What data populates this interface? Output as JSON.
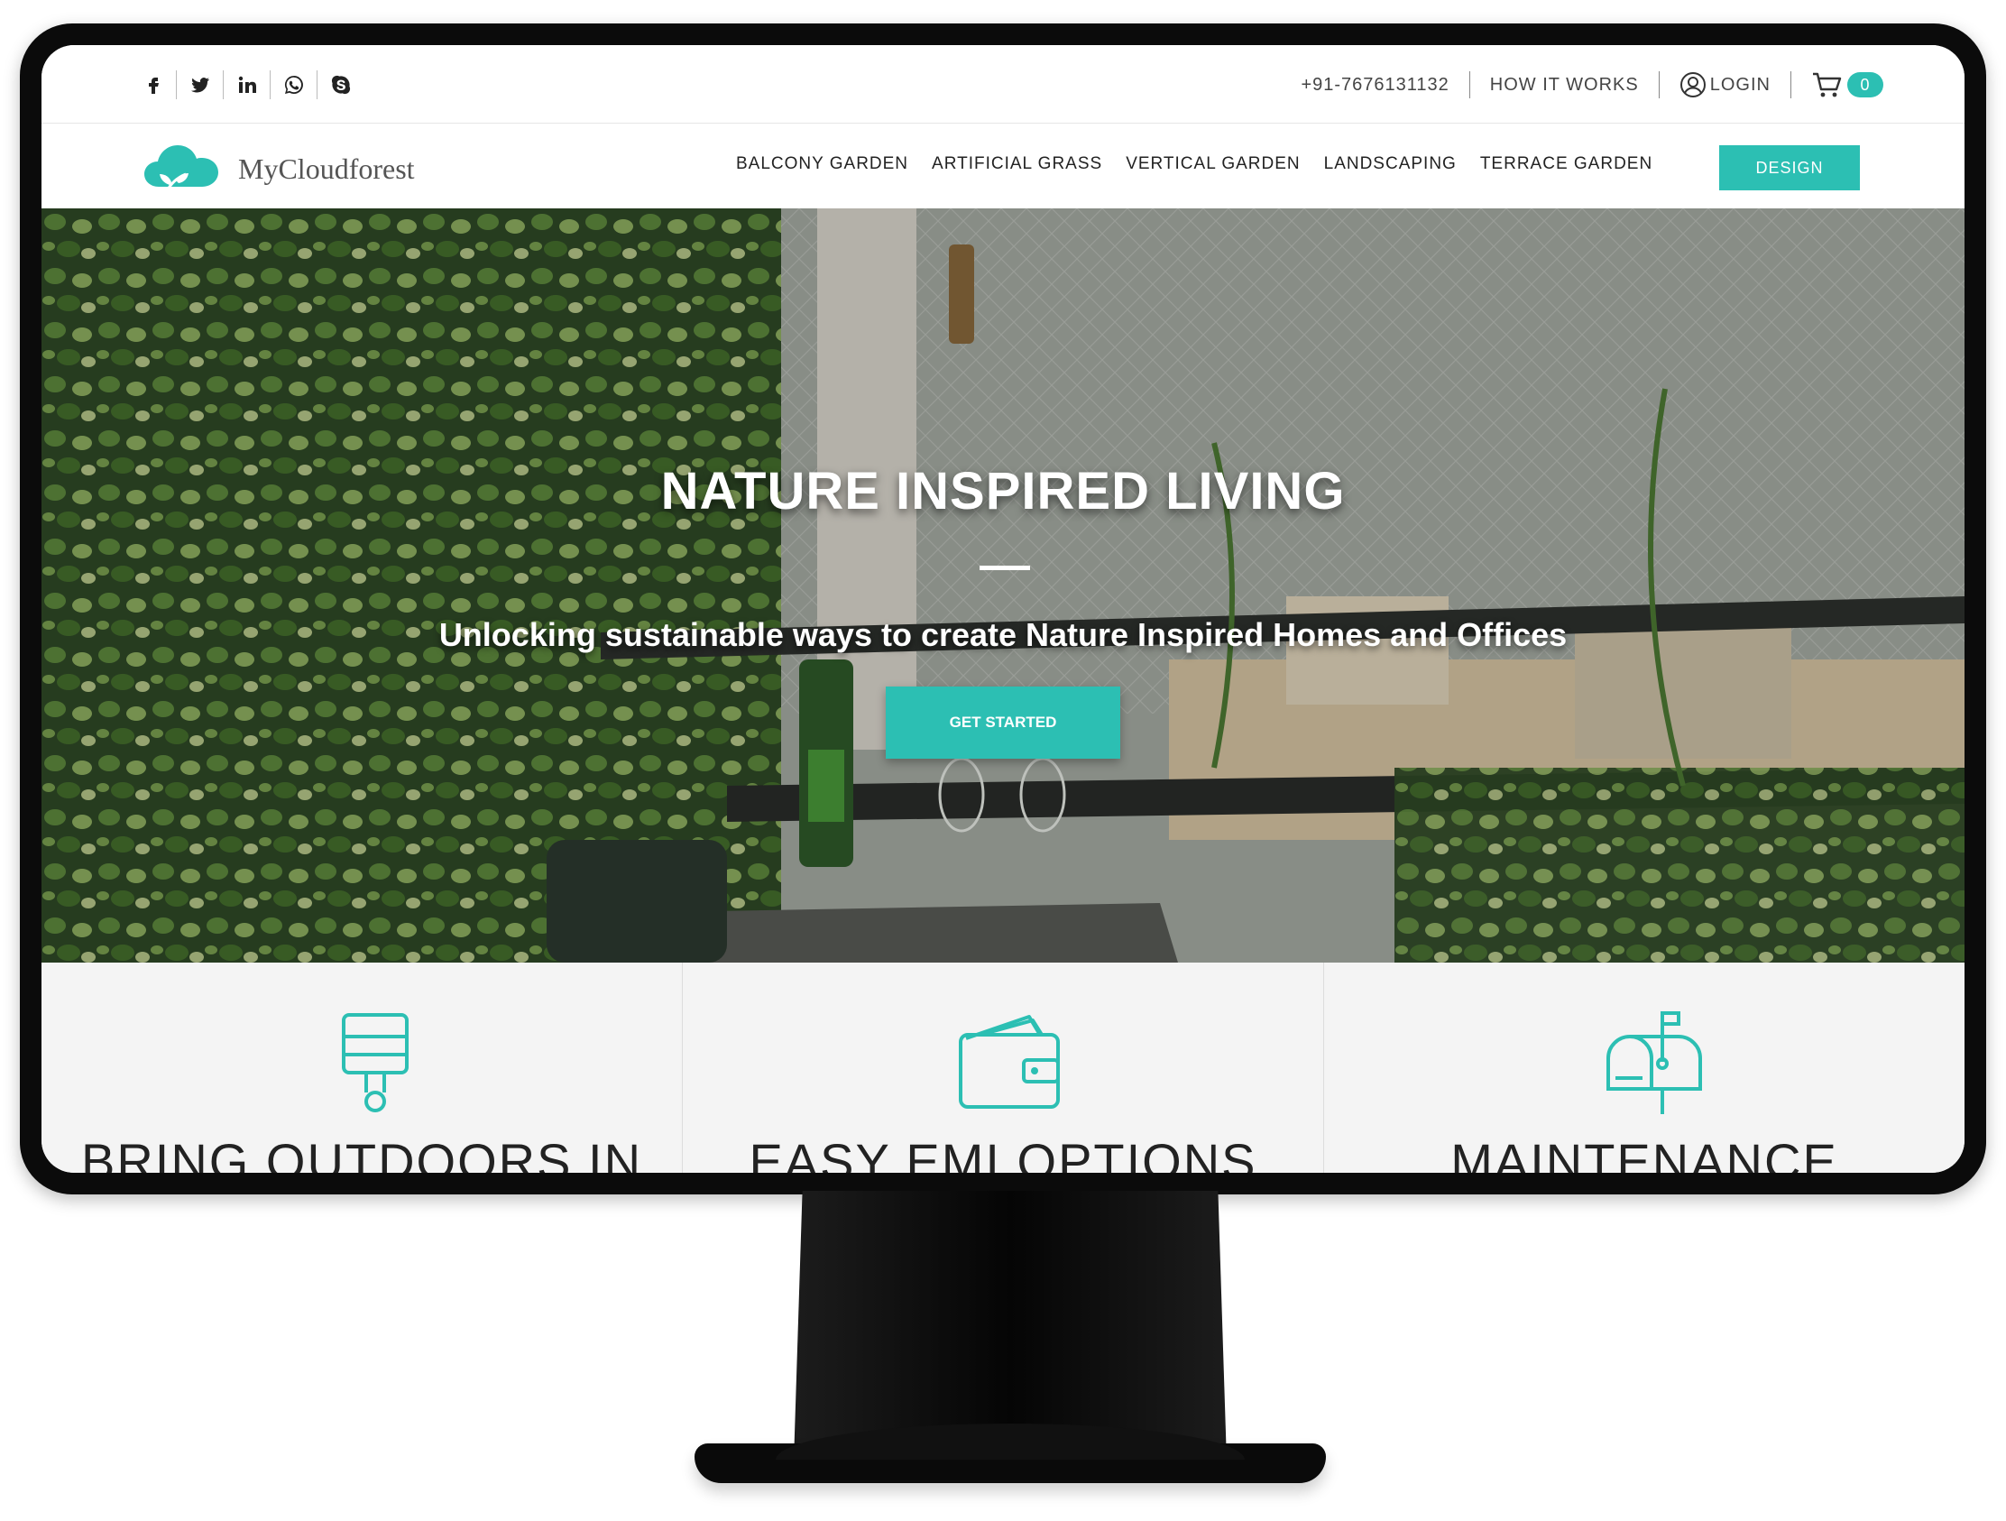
{
  "social_icons": [
    "facebook-icon",
    "twitter-icon",
    "linkedin-icon",
    "whatsapp-icon",
    "skype-icon"
  ],
  "topbar": {
    "phone": "+91-7676131132",
    "how_it_works": "HOW IT WORKS",
    "login": "LOGIN",
    "cart_count": "0"
  },
  "brand": {
    "name": "MyCloudforest"
  },
  "nav": {
    "items": [
      "BALCONY GARDEN",
      "ARTIFICIAL GRASS",
      "VERTICAL GARDEN",
      "LANDSCAPING",
      "TERRACE GARDEN"
    ],
    "cta": "DESIGN"
  },
  "hero": {
    "title": "NATURE INSPIRED LIVING",
    "subtitle": "Unlocking sustainable ways to create Nature Inspired Homes and Offices",
    "button": "GET STARTED"
  },
  "features": [
    {
      "title": "BRING OUTDOORS IN",
      "icon": "paint-brush-icon"
    },
    {
      "title": "EASY EMI OPTIONS",
      "icon": "wallet-icon"
    },
    {
      "title": "MAINTENANCE",
      "icon": "mailbox-icon"
    }
  ],
  "colors": {
    "accent": "#2cbfb3",
    "text_dark": "#222222",
    "frame": "#0b0b0b"
  }
}
